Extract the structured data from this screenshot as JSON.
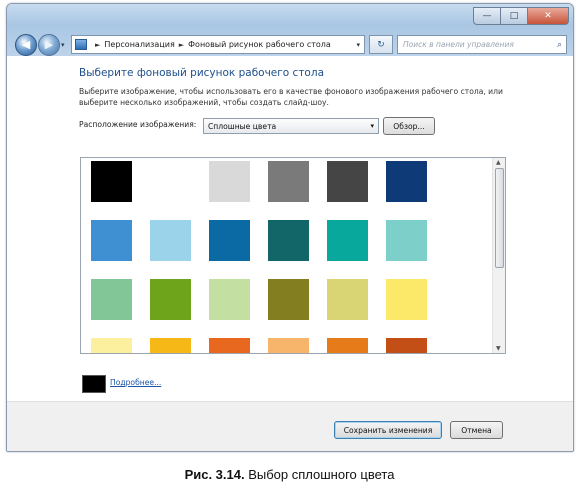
{
  "window": {
    "minimize_glyph": "—",
    "maximize_glyph": "□",
    "close_glyph": "✕"
  },
  "nav": {
    "back_glyph": "◀",
    "forward_glyph": "▶",
    "history_glyph": "▾",
    "breadcrumb": [
      "Персонализация",
      "Фоновый рисунок рабочего стола"
    ],
    "breadcrumb_sep": "►",
    "dropdown_glyph": "▾",
    "refresh_glyph": "↻",
    "search_placeholder": "Поиск в панели управления",
    "search_glyph": "⌕"
  },
  "content": {
    "heading": "Выберите фоновый рисунок рабочего стола",
    "description": "Выберите изображение, чтобы использовать его в качестве фонового изображения рабочего стола, или выберите несколько изображений, чтобы создать слайд-шоу.",
    "location_label": "Расположение изображения:",
    "location_value": "Сплошные цвета",
    "combo_arrow": "▾",
    "browse_label": "Обзор...",
    "swatches": [
      "#000000",
      "#ffffff",
      "#d9d9d9",
      "#7a7a7a",
      "#454545",
      "#0f3a78",
      "#3f8fd3",
      "#9ad3ea",
      "#0b6aa3",
      "#136668",
      "#09a89c",
      "#7dcfca",
      "#82c596",
      "#6ea31c",
      "#c3dfa2",
      "#837f21",
      "#d9d474",
      "#fde969",
      "#fcef9e",
      "#f6b816",
      "#e9681f",
      "#f7b46b",
      "#e67b1a",
      "#c44f16"
    ],
    "selected_color": "#000000",
    "more_link": "Подробнее..."
  },
  "footer": {
    "save_label": "Сохранить изменения",
    "cancel_label": "Отмена"
  },
  "figure_caption": {
    "number": "Рис. 3.14.",
    "text": " Выбор сплошного цвета"
  }
}
